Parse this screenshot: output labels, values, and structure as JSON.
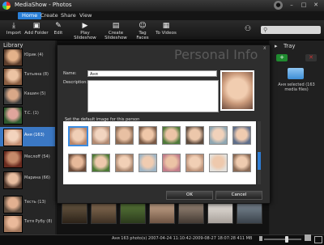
{
  "window": {
    "title": "MediaShow - Photos"
  },
  "menu": [
    "Home",
    "Create",
    "Share",
    "View"
  ],
  "toolbar": [
    {
      "label": "Import",
      "icon": "import-icon"
    },
    {
      "label": "Add Folder",
      "icon": "add-folder-icon"
    },
    {
      "label": "Edit",
      "icon": "edit-icon"
    },
    {
      "label": "Play Slideshow",
      "icon": "play-icon"
    },
    {
      "label": "Create Slideshow",
      "icon": "slideshow-icon"
    },
    {
      "label": "Tag Faces",
      "icon": "tag-faces-icon"
    },
    {
      "label": "To Videos",
      "icon": "video-icon"
    }
  ],
  "search": {
    "placeholder": ""
  },
  "library": {
    "label": "Library",
    "people": [
      {
        "name": "Юрик (4)"
      },
      {
        "name": "Татьяна (8)"
      },
      {
        "name": "Кашин (5)"
      },
      {
        "name": "T.C. (1)"
      },
      {
        "name": "Аня (163)",
        "selected": true
      },
      {
        "name": "Mecлoff (54)"
      },
      {
        "name": "Марина (66)"
      },
      {
        "name": "Тесть (13)"
      },
      {
        "name": "Тетя Рубу (8)"
      }
    ]
  },
  "dialog": {
    "title": "Personal Info",
    "name_label": "Name:",
    "name_value": "Аня",
    "description_label": "Description:",
    "default_image_label": "Set the default image for this person",
    "ok": "OK",
    "cancel": "Cancel",
    "close": "x"
  },
  "tray": {
    "label": "Tray",
    "caption": "Аня selected (163 media files)"
  },
  "status": {
    "text": "Аня 163 photo(s) 2007-04-24 11:10:42-2009-08-27 18:07:28 411 MB"
  },
  "colors": {
    "accent": "#2a7fd6",
    "selected": "#3b78c4",
    "tray_add": "#1f8a2f"
  }
}
